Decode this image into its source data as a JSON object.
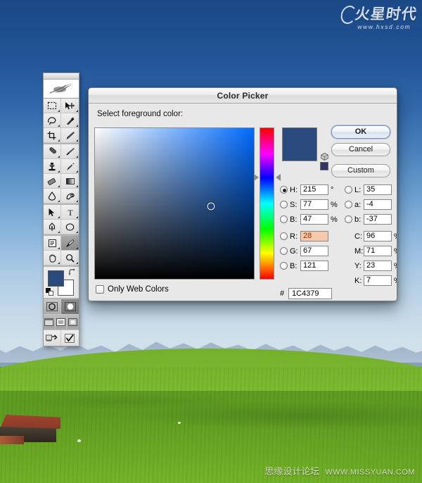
{
  "desktop": {
    "wallpaper_description": "alpine-meadow-photo",
    "sky_top_color": "#1b4887",
    "sky_bottom_color": "#d6e2ea",
    "meadow_color": "#6fae26"
  },
  "watermark_top": {
    "brand_cn": "火星时代",
    "url": "www.hxsd.com"
  },
  "watermark_bottom": {
    "brand_cn": "思缘设计论坛",
    "url": "WWW.MISSYUAN.COM"
  },
  "toolbar": {
    "logo": "photoshop-feather-logo",
    "foreground_color": "#2a4a7d",
    "background_color": "#ffffff",
    "tools": [
      {
        "name": "marquee-tool",
        "icon": "rectangular-marquee"
      },
      {
        "name": "move-tool",
        "icon": "move-arrow"
      },
      {
        "name": "lasso-tool",
        "icon": "lasso"
      },
      {
        "name": "magic-wand-tool",
        "icon": "magic-wand"
      },
      {
        "name": "crop-tool",
        "icon": "crop"
      },
      {
        "name": "slice-tool",
        "icon": "slice-knife"
      },
      {
        "name": "healing-brush-tool",
        "icon": "healing-brush"
      },
      {
        "name": "brush-tool",
        "icon": "paintbrush"
      },
      {
        "name": "clone-stamp-tool",
        "icon": "clone-stamp"
      },
      {
        "name": "history-brush-tool",
        "icon": "history-brush"
      },
      {
        "name": "eraser-tool",
        "icon": "eraser"
      },
      {
        "name": "gradient-tool",
        "icon": "gradient"
      },
      {
        "name": "blur-tool",
        "icon": "waterdrop"
      },
      {
        "name": "dodge-tool",
        "icon": "dodge-hand"
      },
      {
        "name": "path-selection-tool",
        "icon": "black-arrow"
      },
      {
        "name": "type-tool",
        "icon": "letter-t"
      },
      {
        "name": "pen-tool",
        "icon": "pen-nib"
      },
      {
        "name": "shape-tool",
        "icon": "ellipse-shape"
      },
      {
        "name": "notes-tool",
        "icon": "notes-page"
      },
      {
        "name": "eyedropper-tool",
        "icon": "eyedropper"
      },
      {
        "name": "hand-tool",
        "icon": "hand"
      },
      {
        "name": "zoom-tool",
        "icon": "magnifier"
      }
    ]
  },
  "color_picker": {
    "title": "Color Picker",
    "prompt": "Select foreground color:",
    "buttons": {
      "ok": "OK",
      "cancel": "Cancel",
      "custom": "Custom"
    },
    "preview": {
      "new_color": "#2a4a7d",
      "web_safe_swatch": "#333366",
      "web_safe_icon": "cube-icon"
    },
    "hsb": [
      {
        "name": "hue",
        "label": "H:",
        "value": "215",
        "unit": "°",
        "selected": true
      },
      {
        "name": "saturation",
        "label": "S:",
        "value": "77",
        "unit": "%",
        "selected": false
      },
      {
        "name": "brightness",
        "label": "B:",
        "value": "47",
        "unit": "%",
        "selected": false
      }
    ],
    "lab": [
      {
        "name": "lightness",
        "label": "L:",
        "value": "35",
        "unit": "",
        "selected": false
      },
      {
        "name": "a-axis",
        "label": "a:",
        "value": "-4",
        "unit": "",
        "selected": false
      },
      {
        "name": "b-axis",
        "label": "b:",
        "value": "-37",
        "unit": "",
        "selected": false
      }
    ],
    "rgb": [
      {
        "name": "red",
        "label": "R:",
        "value": "28",
        "unit": "",
        "selected": false,
        "alert": true
      },
      {
        "name": "green",
        "label": "G:",
        "value": "67",
        "unit": "",
        "selected": false,
        "alert": false
      },
      {
        "name": "blue",
        "label": "B:",
        "value": "121",
        "unit": "",
        "selected": false,
        "alert": false
      }
    ],
    "cmyk": [
      {
        "name": "cyan",
        "label": "C:",
        "value": "96",
        "unit": "%"
      },
      {
        "name": "magenta",
        "label": "M:",
        "value": "71",
        "unit": "%"
      },
      {
        "name": "yellow",
        "label": "Y:",
        "value": "23",
        "unit": "%"
      },
      {
        "name": "black",
        "label": "K:",
        "value": "7",
        "unit": "%"
      }
    ],
    "hex": {
      "prefix": "#",
      "value": "1C4379"
    },
    "only_web_colors": {
      "label": "Only Web Colors",
      "checked": false
    },
    "field": {
      "marker_x_percent": 73,
      "marker_y_percent": 52,
      "hue_marker_percent": 33
    }
  }
}
